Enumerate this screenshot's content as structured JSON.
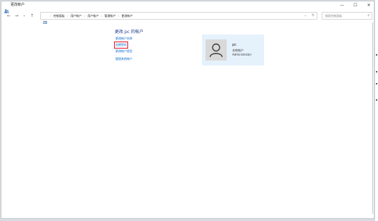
{
  "window": {
    "title": "更改帐户"
  },
  "window_controls": {
    "minimize": "—",
    "maximize": "☐",
    "close": "✕"
  },
  "nav": {
    "back": "←",
    "forward": "→",
    "dropdown": "⌄",
    "up": "↑"
  },
  "breadcrumbs": [
    "控制面板",
    "用户帐户",
    "用户帐户",
    "管理帐户",
    "更改帐户"
  ],
  "breadcrumb_separator": "›",
  "address_dropdown": "⌄",
  "refresh": "↻",
  "search": {
    "placeholder": "搜索控制面板",
    "icon": "⌕"
  },
  "main": {
    "title": "更改 pc 的帐户",
    "links": [
      "更改帐户名称",
      "创建密码",
      "更改帐户类型",
      "管理其他帐户"
    ],
    "highlighted_link_index": 1
  },
  "account": {
    "name": "pc",
    "type": "本地帐户",
    "role": "Administrator"
  },
  "colors": {
    "link": "#0066cc",
    "title": "#1e3a8a",
    "card_bg": "#e5f1fb",
    "highlight_border": "#e81123"
  },
  "icons": {
    "title_icon": "users-icon",
    "address_icon": "control-panel-icon",
    "avatar": "user-avatar-icon"
  }
}
